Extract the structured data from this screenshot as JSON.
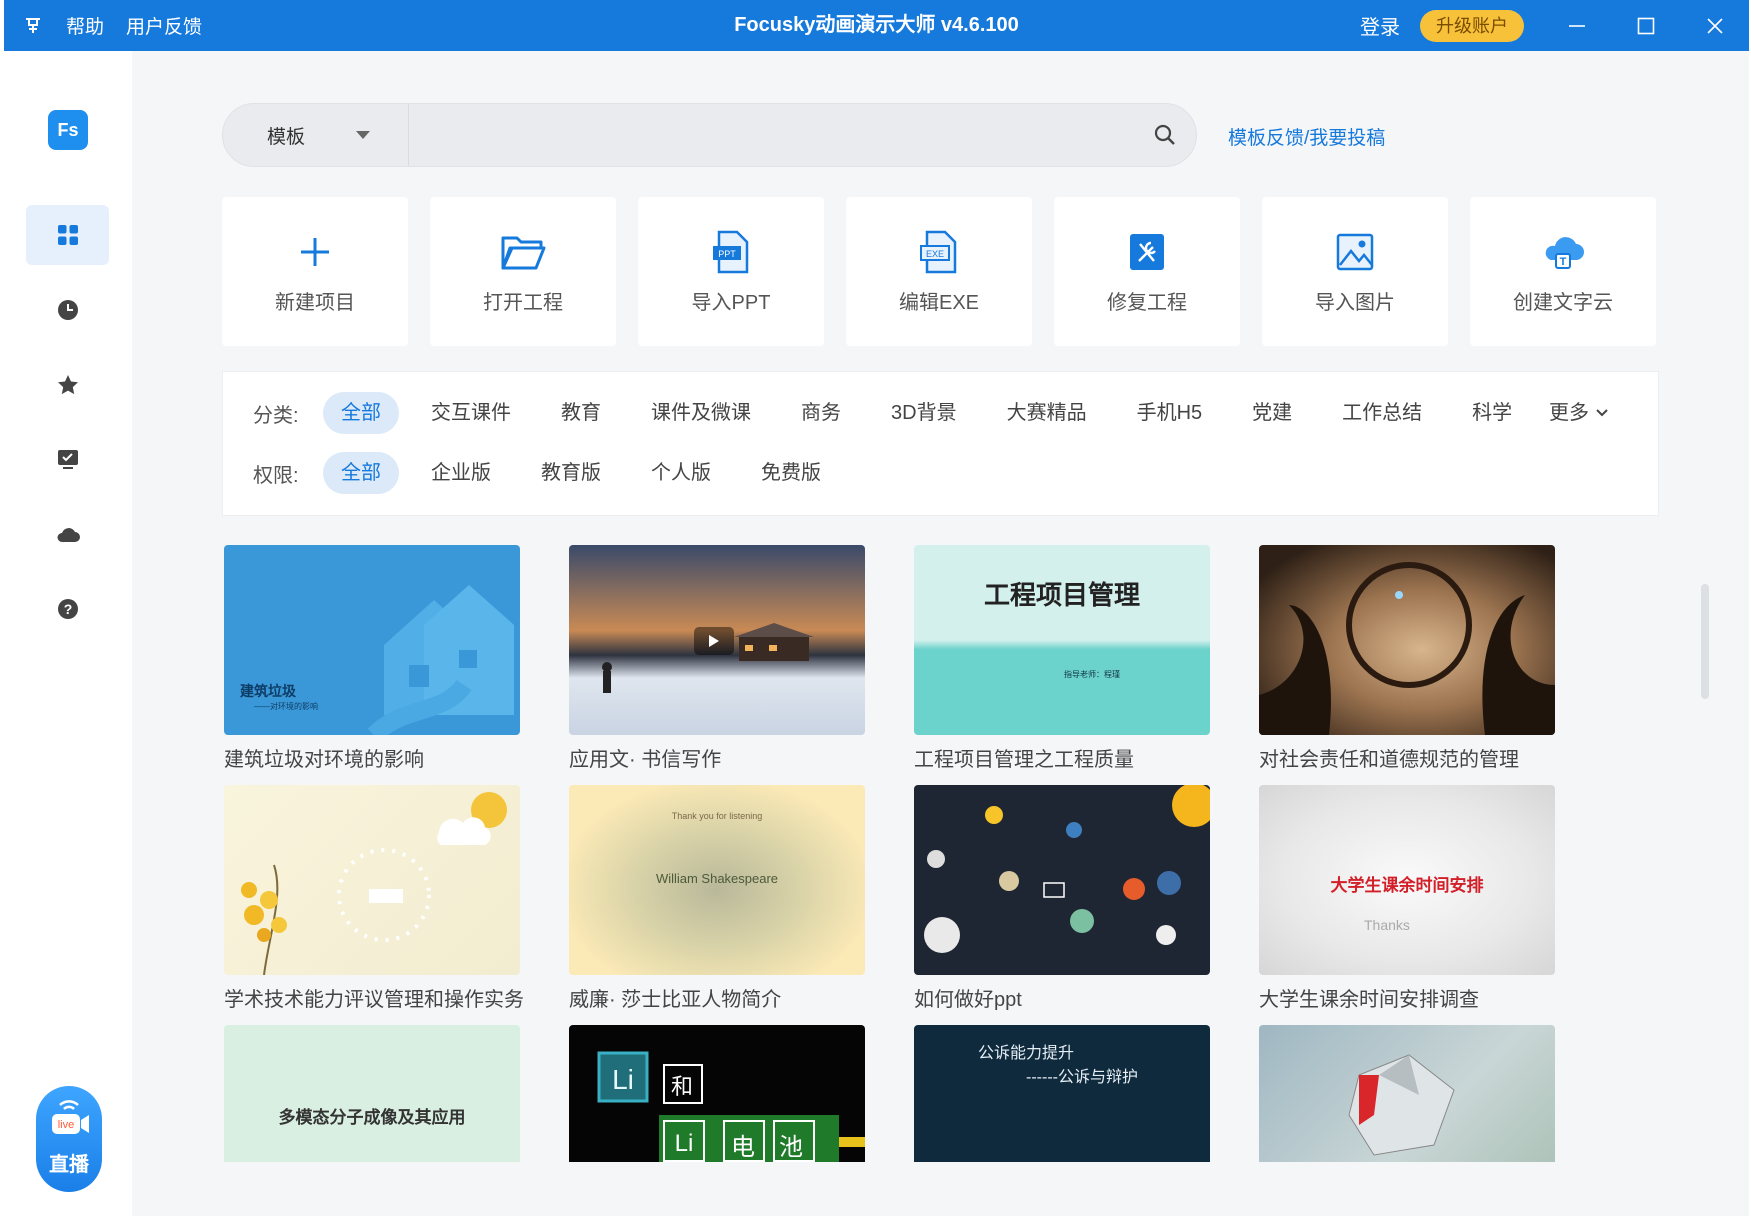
{
  "titlebar": {
    "menu": [
      "帮助",
      "用户反馈"
    ],
    "title": "Focusky动画演示大师 v4.6.100",
    "login": "登录",
    "upgrade": "升级账户"
  },
  "sidebar": {
    "logo": "Fs",
    "items": [
      "apps-grid-icon",
      "clock-icon",
      "star-icon",
      "checklist-icon",
      "cloud-icon",
      "help-icon"
    ],
    "live": {
      "badge": "live",
      "label": "直播"
    }
  },
  "search": {
    "category": "模板",
    "placeholder": "",
    "feedback": "模板反馈/我要投稿"
  },
  "actions": [
    "新建项目",
    "打开工程",
    "导入PPT",
    "编辑EXE",
    "修复工程",
    "导入图片",
    "创建文字云"
  ],
  "filters": {
    "category_title": "分类:",
    "categories": [
      "全部",
      "交互课件",
      "教育",
      "课件及微课",
      "商务",
      "3D背景",
      "大赛精品",
      "手机H5",
      "党建",
      "工作总结",
      "科学"
    ],
    "more": "更多",
    "permission_title": "权限:",
    "permissions": [
      "全部",
      "企业版",
      "教育版",
      "个人版",
      "免费版"
    ]
  },
  "templates": [
    {
      "name": "建筑垃圾对环境的影响",
      "thumb_text": "建筑垃圾",
      "thumb_sub": "——对环境的影响"
    },
    {
      "name": "应用文· 书信写作",
      "thumb_text": "",
      "thumb_sub": ""
    },
    {
      "name": "工程项目管理之工程质量",
      "thumb_text": "工程项目管理",
      "thumb_sub": "指导老师：程瑾"
    },
    {
      "name": "对社会责任和道德规范的管理",
      "thumb_text": "",
      "thumb_sub": ""
    },
    {
      "name": "学术技术能力评议管理和操作实务",
      "thumb_text": "",
      "thumb_sub": ""
    },
    {
      "name": "威廉· 莎士比亚人物简介",
      "thumb_text": "William Shakespeare",
      "thumb_sub": "Thank you for listening"
    },
    {
      "name": "如何做好ppt",
      "thumb_text": "",
      "thumb_sub": ""
    },
    {
      "name": "大学生课余时间安排调查",
      "thumb_text": "大学生课余时间安排",
      "thumb_sub": "Thanks"
    },
    {
      "name": "",
      "thumb_text": "多模态分子成像及其应用",
      "thumb_sub": ""
    },
    {
      "name": "",
      "thumb_text": "和",
      "thumb_sub": "电池"
    },
    {
      "name": "",
      "thumb_text": "公诉能力提升",
      "thumb_sub": "------公诉与辩护"
    },
    {
      "name": "",
      "thumb_text": "",
      "thumb_sub": ""
    }
  ],
  "colors": {
    "accent": "#1679dc",
    "upgrade": "#f8c13a",
    "bg": "#f5f6f8"
  }
}
